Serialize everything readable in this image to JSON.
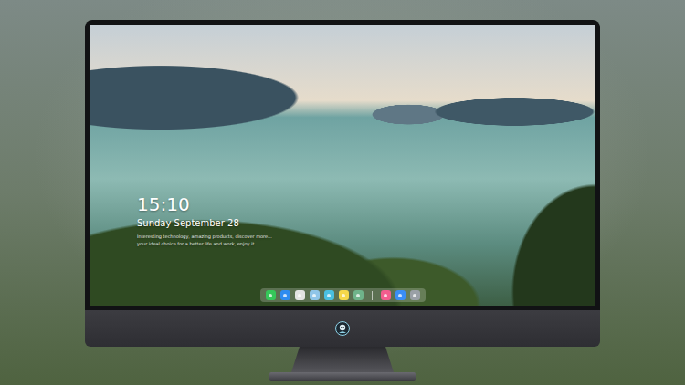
{
  "lock_screen": {
    "time": "15:10",
    "date": "Sunday September 28",
    "caption": [
      "Interesting technology, amazing products, discover more...",
      "your ideal choice for a better life and work, enjoy it"
    ]
  },
  "dock": {
    "items": [
      {
        "kind": "app",
        "color": "#35c759"
      },
      {
        "kind": "app",
        "color": "#2d8cf0"
      },
      {
        "kind": "app",
        "color": "#e4e4e4"
      },
      {
        "kind": "app",
        "color": "#8fc5e8"
      },
      {
        "kind": "app",
        "color": "#4ac0e0"
      },
      {
        "kind": "app",
        "color": "#f5d84a"
      },
      {
        "kind": "app",
        "color": "#6fb38a"
      },
      {
        "kind": "divider",
        "color": "#ffffff"
      },
      {
        "kind": "app",
        "color": "#f25d8e"
      },
      {
        "kind": "app",
        "color": "#3a8ef5"
      },
      {
        "kind": "app",
        "color": "#9aa0a6"
      }
    ]
  }
}
